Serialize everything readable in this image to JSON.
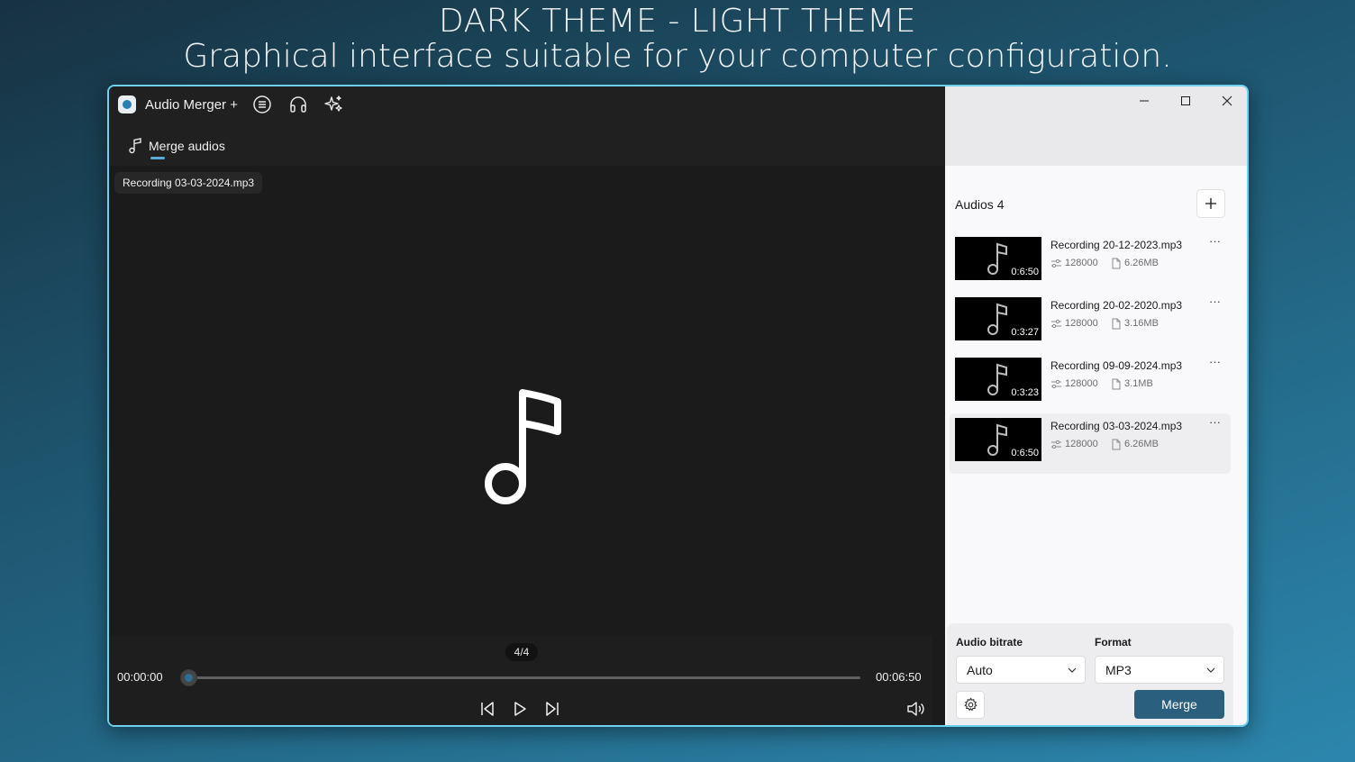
{
  "promo": {
    "heading": "DARK THEME - LIGHT THEME",
    "subheading": "Graphical interface suitable for your computer configuration."
  },
  "app": {
    "title": "Audio Merger +",
    "titlebar_icons": [
      "list-icon",
      "headphones-icon",
      "sparkles-icon"
    ]
  },
  "tabs": [
    {
      "label": "Merge audios",
      "icon": "music-note-icon",
      "selected": true
    }
  ],
  "player": {
    "current_file": "Recording 03-03-2024.mp3",
    "counter": "4/4",
    "current_time": "00:00:00",
    "total_time": "00:06:50",
    "progress": 0.0
  },
  "sidebar": {
    "audios_title": "Audios 4",
    "items": [
      {
        "name": "Recording 20-12-2023.mp3",
        "duration": "0:6:50",
        "bitrate": "128000",
        "size": "6.26MB"
      },
      {
        "name": "Recording 20-02-2020.mp3",
        "duration": "0:3:27",
        "bitrate": "128000",
        "size": "3.16MB"
      },
      {
        "name": "Recording 09-09-2024.mp3",
        "duration": "0:3:23",
        "bitrate": "128000",
        "size": "3.1MB"
      },
      {
        "name": "Recording 03-03-2024.mp3",
        "duration": "0:6:50",
        "bitrate": "128000",
        "size": "6.26MB"
      }
    ],
    "more_label": "···"
  },
  "settings": {
    "bitrate_label": "Audio bitrate",
    "bitrate_value": "Auto",
    "format_label": "Format",
    "format_value": "MP3",
    "merge_label": "Merge"
  },
  "colors": {
    "accent": "#2b5f7e",
    "slider_accent": "#2b6f94",
    "dark_bg": "#202020",
    "light_bg": "#f9f9fb",
    "window_border": "#6fd0ee"
  }
}
